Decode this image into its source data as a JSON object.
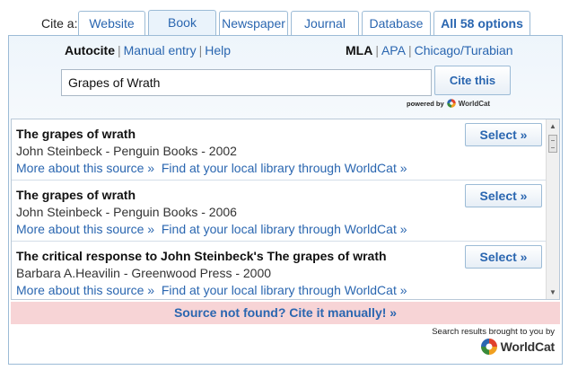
{
  "tabs": {
    "cite_label": "Cite a:",
    "items": [
      {
        "label": "Website"
      },
      {
        "label": "Book"
      },
      {
        "label": "Newspaper"
      },
      {
        "label": "Journal"
      },
      {
        "label": "Database"
      },
      {
        "label": "All 58 options"
      }
    ],
    "active": "Book"
  },
  "modes": {
    "autocite": "Autocite",
    "manual": "Manual entry",
    "help": "Help"
  },
  "styles": {
    "mla": "MLA",
    "apa": "APA",
    "chicago": "Chicago/Turabian"
  },
  "search": {
    "value": "Grapes of Wrath",
    "button": "Cite this",
    "powered_by": "powered by",
    "powered_brand": "WorldCat"
  },
  "results": [
    {
      "title": "The grapes of wrath",
      "meta": "John Steinbeck - Penguin Books - 2002",
      "more": "More about this source »",
      "find": "Find at your local library through WorldCat »",
      "select": "Select »"
    },
    {
      "title": "The grapes of wrath",
      "meta": "John Steinbeck - Penguin Books - 2006",
      "more": "More about this source »",
      "find": "Find at your local library through WorldCat »",
      "select": "Select »"
    },
    {
      "title": "The critical response to John Steinbeck's The grapes of wrath",
      "meta": "Barbara A.Heavilin - Greenwood Press - 2000",
      "more": "More about this source »",
      "find": "Find at your local library through WorldCat »",
      "select": "Select »"
    }
  ],
  "not_found": "Source not found? Cite it manually! »",
  "credit": {
    "text": "Search results brought to you by",
    "brand": "WorldCat"
  },
  "colors": {
    "link": "#2a66b0",
    "border": "#9cbbd6",
    "notfound_bg": "#f7d4d6"
  },
  "icons": [
    "worldcat-logo-icon",
    "scroll-up-icon",
    "scroll-down-icon"
  ]
}
